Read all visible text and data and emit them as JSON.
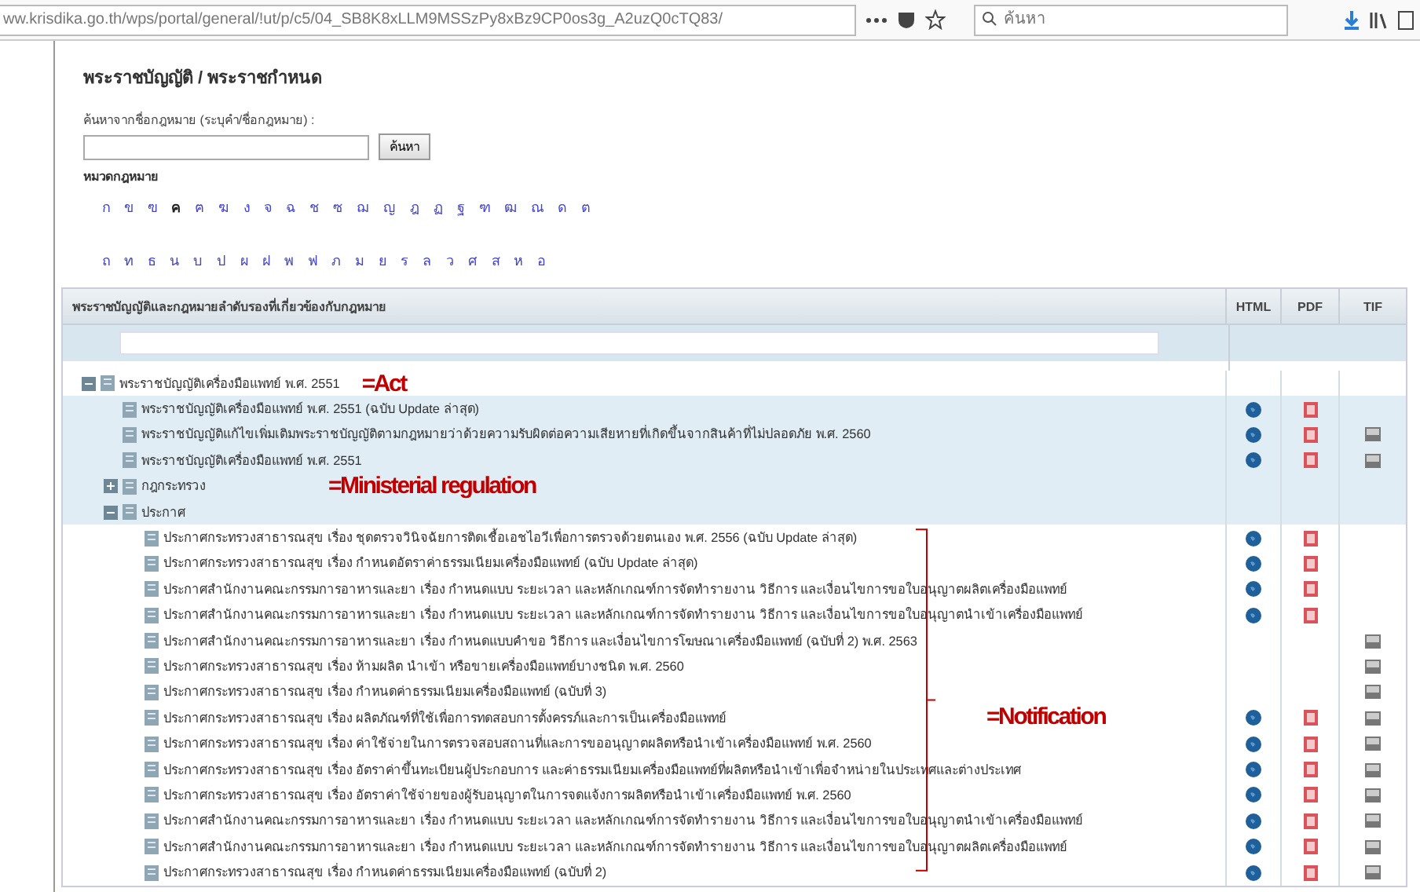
{
  "browser": {
    "url": "ww.krisdika.go.th/wps/portal/general/!ut/p/c5/04_SB8K8xLLM9MSSzPy8xBz9CP0os3g_A2uzQ0cTQ83/",
    "search_placeholder": "ค้นหา"
  },
  "page": {
    "title": "พระราชบัญญัติ / พระราชกำหนด",
    "search_label": "ค้นหาจากชื่อกฎหมาย (ระบุคำ/ชื่อกฎหมาย) :",
    "search_button": "ค้นหา",
    "category_label": "หมวดกฎหมาย",
    "letter_rows": [
      [
        {
          "text": "ก",
          "selected": false
        },
        {
          "text": "ข",
          "selected": false
        },
        {
          "text": "ฃ",
          "selected": false
        },
        {
          "text": "ค",
          "selected": true
        },
        {
          "text": "ฅ",
          "selected": false
        },
        {
          "text": "ฆ",
          "selected": false
        },
        {
          "text": "ง",
          "selected": false
        },
        {
          "text": "จ",
          "selected": false
        },
        {
          "text": "ฉ",
          "selected": false
        },
        {
          "text": "ช",
          "selected": false
        },
        {
          "text": "ซ",
          "selected": false
        },
        {
          "text": "ฌ",
          "selected": false
        },
        {
          "text": "ญ",
          "selected": false
        },
        {
          "text": "ฎ",
          "selected": false
        },
        {
          "text": "ฏ",
          "selected": false
        },
        {
          "text": "ฐ",
          "selected": false
        },
        {
          "text": "ฑ",
          "selected": false
        },
        {
          "text": "ฒ",
          "selected": false
        },
        {
          "text": "ณ",
          "selected": false
        },
        {
          "text": "ด",
          "selected": false
        },
        {
          "text": "ต",
          "selected": false
        }
      ],
      [
        {
          "text": "ถ",
          "selected": false
        },
        {
          "text": "ท",
          "selected": false
        },
        {
          "text": "ธ",
          "selected": false
        },
        {
          "text": "น",
          "selected": false
        },
        {
          "text": "บ",
          "selected": false
        },
        {
          "text": "ป",
          "selected": false
        },
        {
          "text": "ผ",
          "selected": false
        },
        {
          "text": "ฝ",
          "selected": false
        },
        {
          "text": "พ",
          "selected": false
        },
        {
          "text": "ฟ",
          "selected": false
        },
        {
          "text": "ภ",
          "selected": false
        },
        {
          "text": "ม",
          "selected": false
        },
        {
          "text": "ย",
          "selected": false
        },
        {
          "text": "ร",
          "selected": false
        },
        {
          "text": "ล",
          "selected": false
        },
        {
          "text": "ว",
          "selected": false
        },
        {
          "text": "ศ",
          "selected": false
        },
        {
          "text": "ส",
          "selected": false
        },
        {
          "text": "ห",
          "selected": false
        },
        {
          "text": "อ",
          "selected": false
        }
      ]
    ]
  },
  "table": {
    "columns": [
      "พระราชบัญญัติและกฎหมายลำดับรองที่เกี่ยวข้องกับกฎหมาย",
      "HTML",
      "PDF",
      "TIF"
    ],
    "tree": [
      {
        "label": "พระราชบัญญัติเครื่องมือแพทย์ พ.ศ. 2551",
        "expanded": true,
        "shaded": false,
        "html": false,
        "pdf": false,
        "tif": false,
        "note": {
          "kind": "inline",
          "text": "=Act"
        },
        "children": [
          {
            "label": "พระราชบัญญัติเครื่องมือแพทย์ พ.ศ. 2551 (ฉบับ Update ล่าสุด)",
            "shaded": true,
            "html": true,
            "pdf": true,
            "tif": false
          },
          {
            "label": "พระราชบัญญัติแก้ไขเพิ่มเติมพระราชบัญญัติตามกฎหมายว่าด้วยความรับผิดต่อความเสียหายที่เกิดขึ้นจากสินค้าที่ไม่ปลอดภัย พ.ศ. 2560",
            "shaded": true,
            "html": true,
            "pdf": true,
            "tif": true
          },
          {
            "label": "พระราชบัญญัติเครื่องมือแพทย์ พ.ศ. 2551",
            "shaded": true,
            "html": true,
            "pdf": true,
            "tif": true
          },
          {
            "label": "กฎกระทรวง",
            "expanded": false,
            "shaded": true,
            "html": false,
            "pdf": false,
            "tif": false,
            "note": {
              "kind": "above",
              "text": "=Ministerial regulation"
            }
          },
          {
            "label": "ประกาศ",
            "expanded": true,
            "shaded": true,
            "html": false,
            "pdf": false,
            "tif": false,
            "note": {
              "kind": "bracket",
              "text": "=Notification"
            },
            "children": [
              {
                "label": "ประกาศกระทรวงสาธารณสุข เรื่อง ชุดตรวจวินิจฉัยการติดเชื้อเอชไอวีเพื่อการตรวจด้วยตนเอง พ.ศ. 2556 (ฉบับ Update ล่าสุด)",
                "shaded": false,
                "html": true,
                "pdf": true,
                "tif": false
              },
              {
                "label": "ประกาศกระทรวงสาธารณสุข เรื่อง กำหนดอัตราค่าธรรมเนียมเครื่องมือแพทย์ (ฉบับ Update ล่าสุด)",
                "shaded": false,
                "html": true,
                "pdf": true,
                "tif": false
              },
              {
                "label": "ประกาศสำนักงานคณะกรรมการอาหารและยา เรื่อง กำหนดแบบ ระยะเวลา และหลักเกณฑ์การจัดทำรายงาน วิธีการ และเงื่อนไขการขอใบอนุญาตผลิตเครื่องมือแพทย์",
                "shaded": false,
                "html": true,
                "pdf": true,
                "tif": false
              },
              {
                "label": "ประกาศสำนักงานคณะกรรมการอาหารและยา เรื่อง กำหนดแบบ ระยะเวลา และหลักเกณฑ์การจัดทำรายงาน วิธีการ และเงื่อนไขการขอใบอนุญาตนำเข้าเครื่องมือแพทย์",
                "shaded": false,
                "html": true,
                "pdf": true,
                "tif": false
              },
              {
                "label": "ประกาศสำนักงานคณะกรรมการอาหารและยา เรื่อง กำหนดแบบคำขอ วิธีการ และเงื่อนไขการโฆษณาเครื่องมือแพทย์ (ฉบับที่ 2) พ.ศ. 2563",
                "shaded": false,
                "html": false,
                "pdf": false,
                "tif": true
              },
              {
                "label": "ประกาศกระทรวงสาธารณสุข เรื่อง ห้ามผลิต นำเข้า หรือขายเครื่องมือแพทย์บางชนิด พ.ศ. 2560",
                "shaded": false,
                "html": false,
                "pdf": false,
                "tif": true
              },
              {
                "label": "ประกาศกระทรวงสาธารณสุข เรื่อง กำหนดค่าธรรมเนียมเครื่องมือแพทย์ (ฉบับที่ 3)",
                "shaded": false,
                "html": false,
                "pdf": false,
                "tif": true
              },
              {
                "label": "ประกาศกระทรวงสาธารณสุข เรื่อง ผลิตภัณฑ์ที่ใช้เพื่อการทดสอบการตั้งครรภ์และการเป็นเครื่องมือแพทย์",
                "shaded": false,
                "html": true,
                "pdf": true,
                "tif": true
              },
              {
                "label": "ประกาศกระทรวงสาธารณสุข เรื่อง ค่าใช้จ่ายในการตรวจสอบสถานที่และการขออนุญาตผลิตหรือนำเข้าเครื่องมือแพทย์ พ.ศ. 2560",
                "shaded": false,
                "html": true,
                "pdf": true,
                "tif": true
              },
              {
                "label": "ประกาศกระทรวงสาธารณสุข เรื่อง อัตราค่าขึ้นทะเบียนผู้ประกอบการ และค่าธรรมเนียมเครื่องมือแพทย์ที่ผลิตหรือนำเข้าเพื่อจำหน่ายในประเทศและต่างประเทศ",
                "shaded": false,
                "html": true,
                "pdf": true,
                "tif": true
              },
              {
                "label": "ประกาศกระทรวงสาธารณสุข เรื่อง อัตราค่าใช้จ่ายของผู้รับอนุญาตในการจดแจ้งการผลิตหรือนำเข้าเครื่องมือแพทย์ พ.ศ. 2560",
                "shaded": false,
                "html": true,
                "pdf": true,
                "tif": true
              },
              {
                "label": "ประกาศสำนักงานคณะกรรมการอาหารและยา เรื่อง กำหนดแบบ ระยะเวลา และหลักเกณฑ์การจัดทำรายงาน วิธีการ และเงื่อนไขการขอใบอนุญาตนำเข้าเครื่องมือแพทย์",
                "shaded": false,
                "html": true,
                "pdf": true,
                "tif": true
              },
              {
                "label": "ประกาศสำนักงานคณะกรรมการอาหารและยา เรื่อง กำหนดแบบ ระยะเวลา และหลักเกณฑ์การจัดทำรายงาน วิธีการ และเงื่อนไขการขอใบอนุญาตผลิตเครื่องมือแพทย์",
                "shaded": false,
                "html": true,
                "pdf": true,
                "tif": true
              },
              {
                "label": "ประกาศกระทรวงสาธารณสุข เรื่อง กำหนดค่าธรรมเนียมเครื่องมือแพทย์ (ฉบับที่ 2)",
                "shaded": false,
                "html": true,
                "pdf": true,
                "tif": true
              }
            ]
          }
        ]
      }
    ]
  }
}
